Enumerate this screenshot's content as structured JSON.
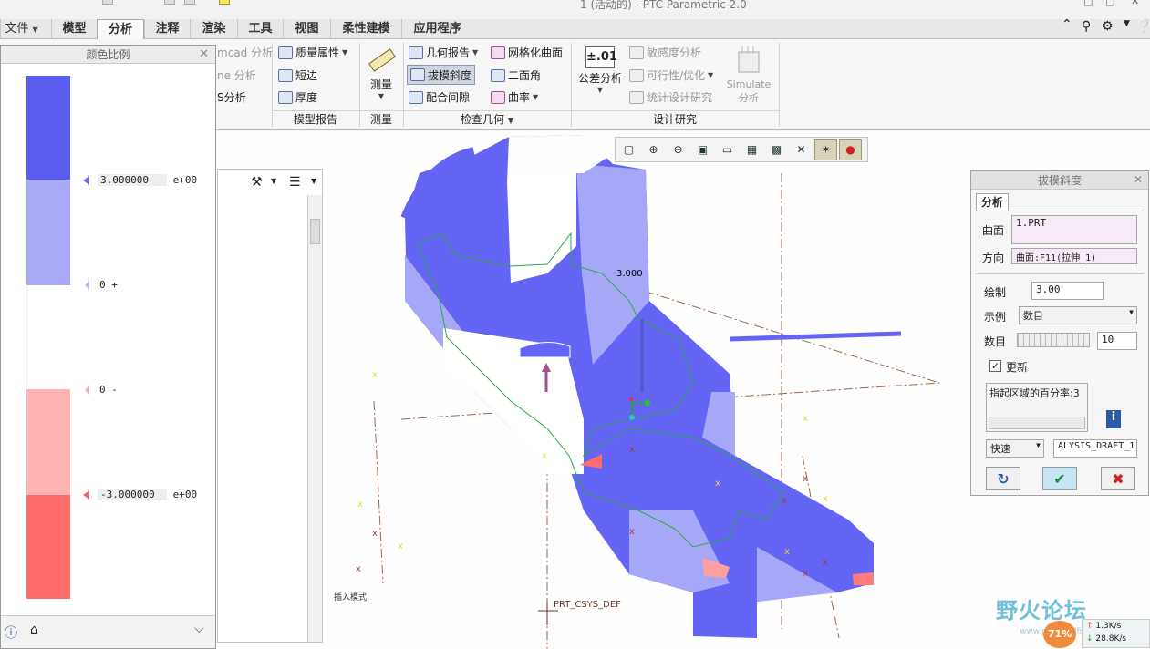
{
  "titlebar": {
    "title": "1 (活动的) - PTC Parametric 2.0"
  },
  "tabs": [
    {
      "label": "文件",
      "has_caret": true
    },
    {
      "label": "模型"
    },
    {
      "label": "分析",
      "active": true
    },
    {
      "label": "注释"
    },
    {
      "label": "渲染"
    },
    {
      "label": "工具"
    },
    {
      "label": "视图"
    },
    {
      "label": "柔性建模"
    },
    {
      "label": "应用程序"
    }
  ],
  "ribbon": {
    "partial": {
      "mcad": "mcad 分析",
      "ne": "ne 分析",
      "s": "S分析"
    },
    "model_report": {
      "mass_props": "质量属性",
      "short_edge": "短边",
      "thickness": "厚度",
      "group_label": "模型报告"
    },
    "measure": {
      "label": "测量",
      "group_label": "测量"
    },
    "inspect": {
      "geometry_report": "几何报告",
      "draft": "拔模斜度",
      "clearance": "配合间隙",
      "mesh_surface": "网格化曲面",
      "dihedral": "二面角",
      "curvature": "曲率",
      "group_label": "检查几何"
    },
    "design": {
      "tolerance_value": "±.01",
      "tolerance": "公差分析",
      "sensitivity": "敏感度分析",
      "feasibility": "可行性/优化",
      "statistical": "统计设计研究",
      "simulate_1": "Simulate",
      "simulate_2": "分析",
      "group_label": "设计研究"
    }
  },
  "color_scale": {
    "title": "颜色比例",
    "ticks": [
      {
        "value": "3.000000",
        "exp": "e+00"
      },
      {
        "value": "0 +"
      },
      {
        "value": "0 -"
      },
      {
        "value": "-3.000000",
        "exp": "e+00"
      }
    ],
    "bands": [
      "#5b5bf0",
      "#a9a9f8",
      "#ffffff",
      "#ffb3b3",
      "#ff6a6a"
    ]
  },
  "model_tree": {
    "note": "插入模式"
  },
  "viewport": {
    "label_3000": "3.000",
    "csys_label": "PRT_CSYS_DEF"
  },
  "draft_dialog": {
    "title": "拔模斜度",
    "tab": "分析",
    "surface_label": "曲面",
    "surface_value": "1.PRT",
    "direction_label": "方向",
    "direction_value": "曲面:F11(拉伸_1)",
    "draw_label": "绘制",
    "draw_value": "3.00",
    "display_label": "示例",
    "display_value": "数目",
    "count_label": "数目",
    "count_value": "10",
    "update_label": "更新",
    "update_checked": true,
    "percent_text": "指起区域的百分率:3",
    "speed_value": "快速",
    "name_value": "ALYSIS_DRAFT_1"
  },
  "watermark": {
    "text": "野火论坛",
    "sub": "www.proewildfire.cn"
  },
  "net_speed": {
    "percent": "71%",
    "up": "1.3K/s",
    "down": "28.8K/s"
  }
}
